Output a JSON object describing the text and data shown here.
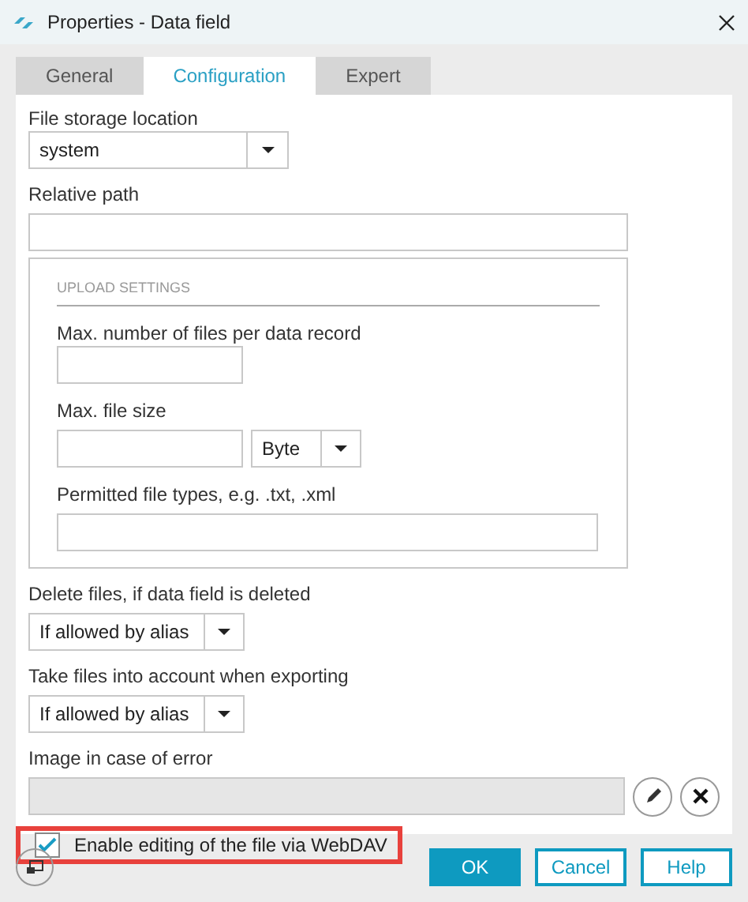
{
  "window": {
    "title": "Properties - Data field"
  },
  "tabs": [
    {
      "label": "General",
      "selected": false
    },
    {
      "label": "Configuration",
      "selected": true
    },
    {
      "label": "Expert",
      "selected": false
    }
  ],
  "storage": {
    "label": "File storage location",
    "value": "system"
  },
  "relative_path": {
    "label": "Relative path"
  },
  "upload": {
    "title": "UPLOAD SETTINGS",
    "max_files_label": "Max. number of files per data record",
    "max_size_label": "Max. file size",
    "unit": "Byte",
    "types_label": "Permitted file types, e.g. .txt, .xml"
  },
  "delete_files": {
    "label": "Delete files, if data field is deleted",
    "value": "If allowed by alias"
  },
  "export_files": {
    "label": "Take files into account when exporting",
    "value": "If allowed by alias"
  },
  "error_image": {
    "label": "Image in case of error",
    "disabled": true
  },
  "webdav": {
    "label": "Enable editing of the file via WebDAV",
    "checked": true,
    "highlighted": true
  },
  "buttons": [
    {
      "label": "OK",
      "kind": "primary"
    },
    {
      "label": "Cancel",
      "kind": "secondary"
    },
    {
      "label": "Help",
      "kind": "secondary"
    }
  ]
}
